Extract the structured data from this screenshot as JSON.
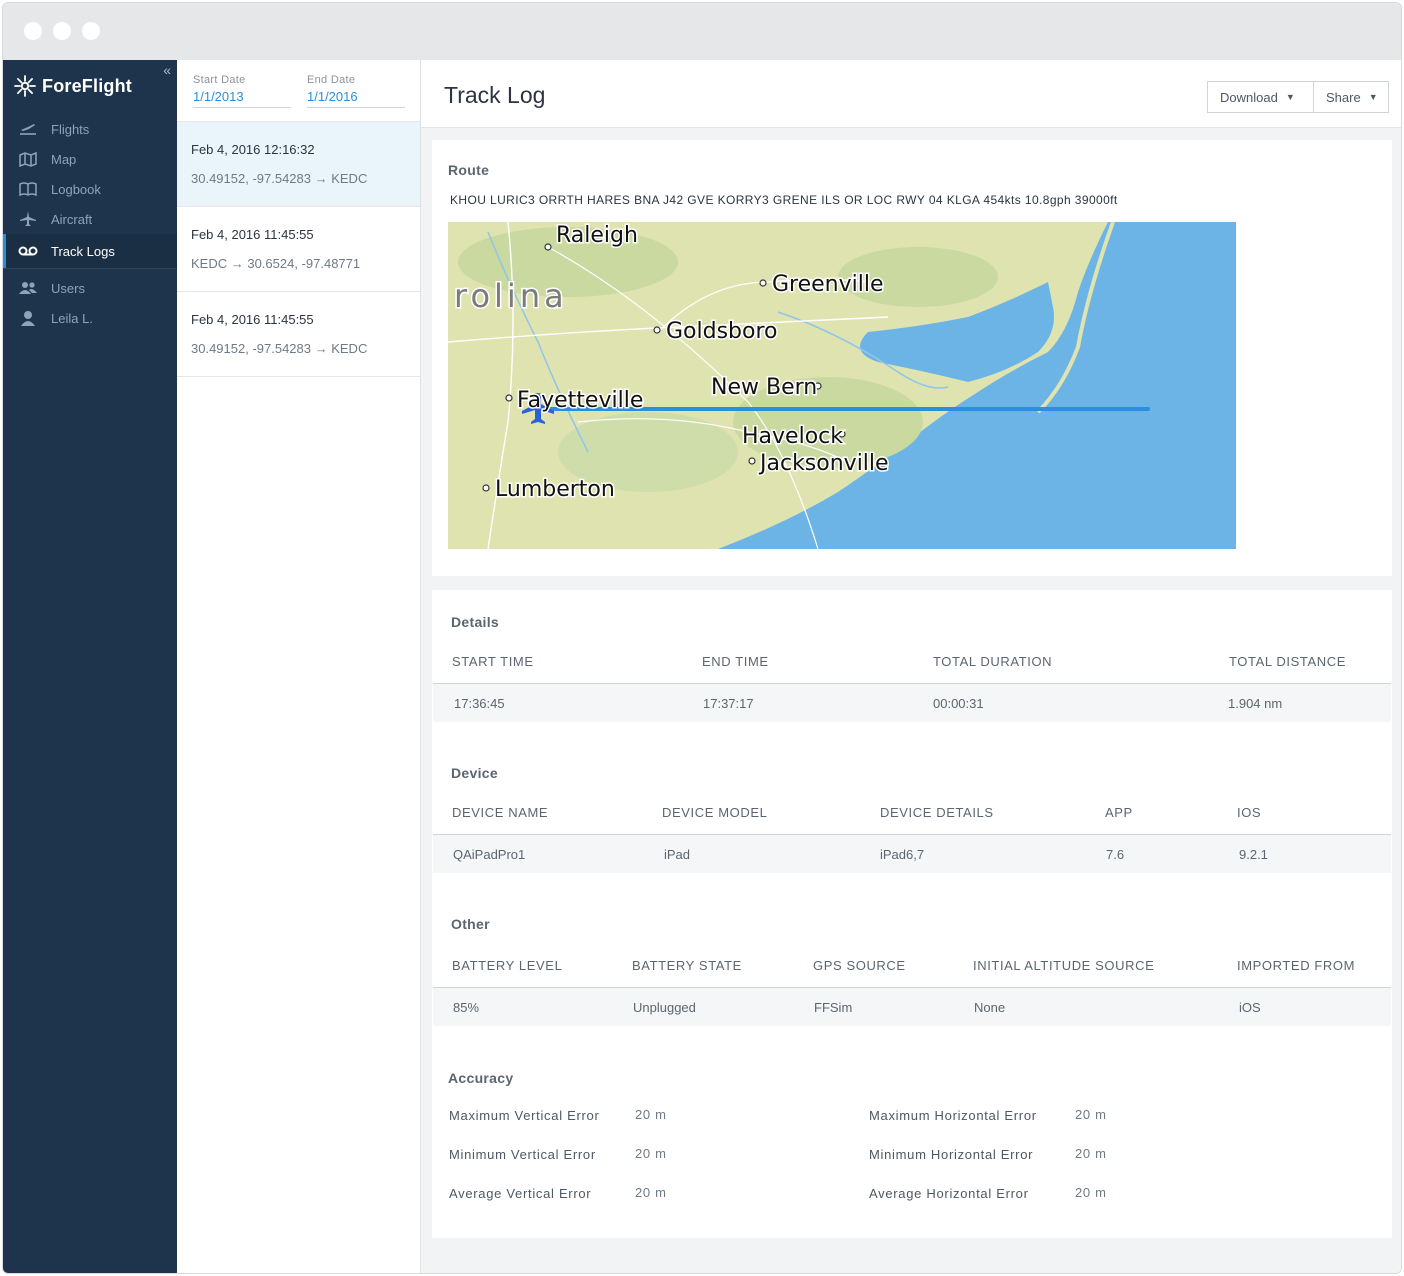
{
  "app": {
    "brand": "ForeFlight",
    "collapse": "«"
  },
  "sidebar": {
    "items": [
      {
        "label": "Flights",
        "icon": "flights-icon"
      },
      {
        "label": "Map",
        "icon": "map-icon"
      },
      {
        "label": "Logbook",
        "icon": "logbook-icon"
      },
      {
        "label": "Aircraft",
        "icon": "aircraft-icon"
      },
      {
        "label": "Track Logs",
        "icon": "track-logs-icon",
        "active": true
      },
      {
        "label": "Users",
        "icon": "users-icon"
      },
      {
        "label": "Leila L.",
        "icon": "user-icon"
      }
    ]
  },
  "filters": {
    "start_label": "Start Date",
    "start_value": "1/1/2013",
    "end_label": "End Date",
    "end_value": "1/1/2016"
  },
  "logs": [
    {
      "time": "Feb 4, 2016 12:16:32",
      "route": "30.49152, -97.54283 → KEDC",
      "selected": true
    },
    {
      "time": "Feb 4, 2016 11:45:55",
      "route": "KEDC → 30.6524, -97.48771"
    },
    {
      "time": "Feb 4, 2016 11:45:55",
      "route": "30.49152, -97.54283 → KEDC"
    }
  ],
  "header": {
    "title": "Track Log",
    "download": "Download",
    "share": "Share"
  },
  "route": {
    "title": "Route",
    "string": "KHOU LURIC3 ORRTH HARES BNA J42 GVE KORRY3 GRENE ILS OR LOC RWY 04 KLGA 454kts 10.8gph 39000ft",
    "map_labels": {
      "raleigh": "Raleigh",
      "rolina": "rolina",
      "greenville": "Greenville",
      "goldsboro": "Goldsboro",
      "new_bern": "New Bern",
      "fayetteville": "Fayetteville",
      "havelock": "Havelock",
      "jacksonville": "Jacksonville",
      "lumberton": "Lumberton"
    }
  },
  "details": {
    "title": "Details",
    "headers": [
      "START TIME",
      "END TIME",
      "TOTAL DURATION",
      "TOTAL DISTANCE"
    ],
    "values": [
      "17:36:45",
      "17:37:17",
      "00:00:31",
      "1.904 nm"
    ]
  },
  "device": {
    "title": "Device",
    "headers": [
      "DEVICE NAME",
      "DEVICE MODEL",
      "DEVICE DETAILS",
      "APP",
      "IOS"
    ],
    "values": [
      "QAiPadPro1",
      "iPad",
      "iPad6,7",
      "7.6",
      "9.2.1"
    ]
  },
  "other": {
    "title": "Other",
    "headers": [
      "BATTERY LEVEL",
      "BATTERY STATE",
      "GPS SOURCE",
      "INITIAL ALTITUDE SOURCE",
      "IMPORTED FROM"
    ],
    "values": [
      "85%",
      "Unplugged",
      "FFSim",
      "None",
      "iOS"
    ]
  },
  "accuracy": {
    "title": "Accuracy",
    "rows": [
      {
        "label": "Maximum Vertical Error",
        "value": "20 m"
      },
      {
        "label": "Minimum Vertical Error",
        "value": "20 m"
      },
      {
        "label": "Average Vertical Error",
        "value": "20 m"
      },
      {
        "label": "Maximum Horizontal Error",
        "value": "20 m"
      },
      {
        "label": "Minimum Horizontal Error",
        "value": "20 m"
      },
      {
        "label": "Average Horizontal Error",
        "value": "20 m"
      }
    ]
  },
  "colors": {
    "sidebar": "#1e344c",
    "accent": "#2a8fd8",
    "water": "#6cb4e6",
    "land": "#dfe3b0",
    "track": "#2b8ee0"
  }
}
